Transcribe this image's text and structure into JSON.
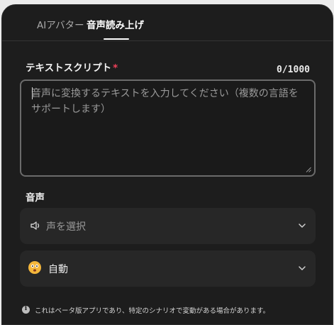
{
  "tabs": {
    "items": [
      {
        "label": "AIアバター",
        "active": false
      },
      {
        "label": "音声読み上げ",
        "active": true
      }
    ]
  },
  "script_section": {
    "label": "テキストスクリプト",
    "required_mark": "*",
    "counter": "0/1000",
    "placeholder": "音声に変換するテキストを入力してください（複数の言語をサポートします）",
    "value": ""
  },
  "voice_section": {
    "label": "音声",
    "voice_select": {
      "placeholder": "声を選択",
      "icon": "speaker-icon"
    },
    "mode_select": {
      "value": "自動",
      "icon": "emoji-face-icon"
    }
  },
  "notice": {
    "icon": "info-icon",
    "text": "これはベータ版アプリであり、特定のシナリオで変動がある場合があります。"
  },
  "colors": {
    "panel_bg": "#1d1d1d",
    "select_bg": "#272727",
    "required": "#f0415a",
    "emoji": "#f5b73b"
  }
}
